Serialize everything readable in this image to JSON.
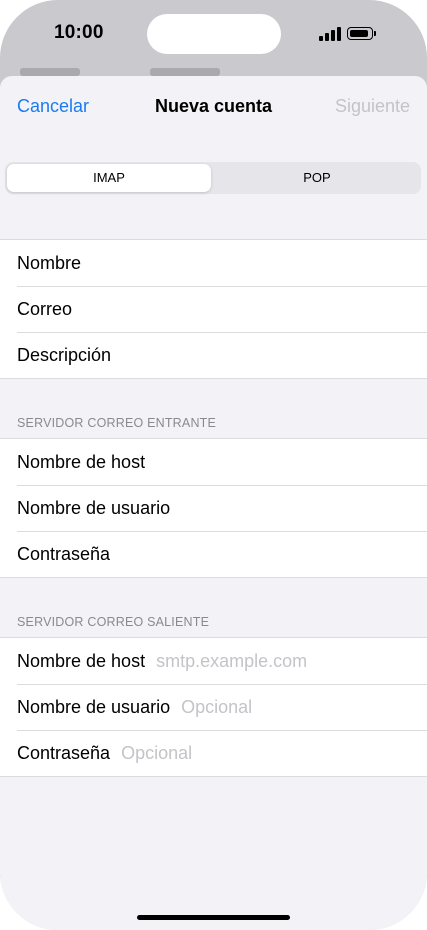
{
  "status": {
    "time": "10:00"
  },
  "nav": {
    "cancel": "Cancelar",
    "title": "Nueva cuenta",
    "next": "Siguiente"
  },
  "segments": {
    "imap": "IMAP",
    "pop": "POP",
    "selected": "IMAP"
  },
  "account": {
    "name_label": "Nombre",
    "email_label": "Correo",
    "description_label": "Descripción"
  },
  "incoming": {
    "header": "SERVIDOR CORREO ENTRANTE",
    "host_label": "Nombre de host",
    "user_label": "Nombre de usuario",
    "password_label": "Contraseña"
  },
  "outgoing": {
    "header": "SERVIDOR CORREO SALIENTE",
    "host_label": "Nombre de host",
    "host_placeholder": "smtp.example.com",
    "user_label": "Nombre de usuario",
    "user_placeholder": "Opcional",
    "password_label": "Contraseña",
    "password_placeholder": "Opcional"
  },
  "colors": {
    "accent": "#1a7cf0",
    "disabled": "#c4c4c8",
    "background": "#f2f2f7"
  }
}
